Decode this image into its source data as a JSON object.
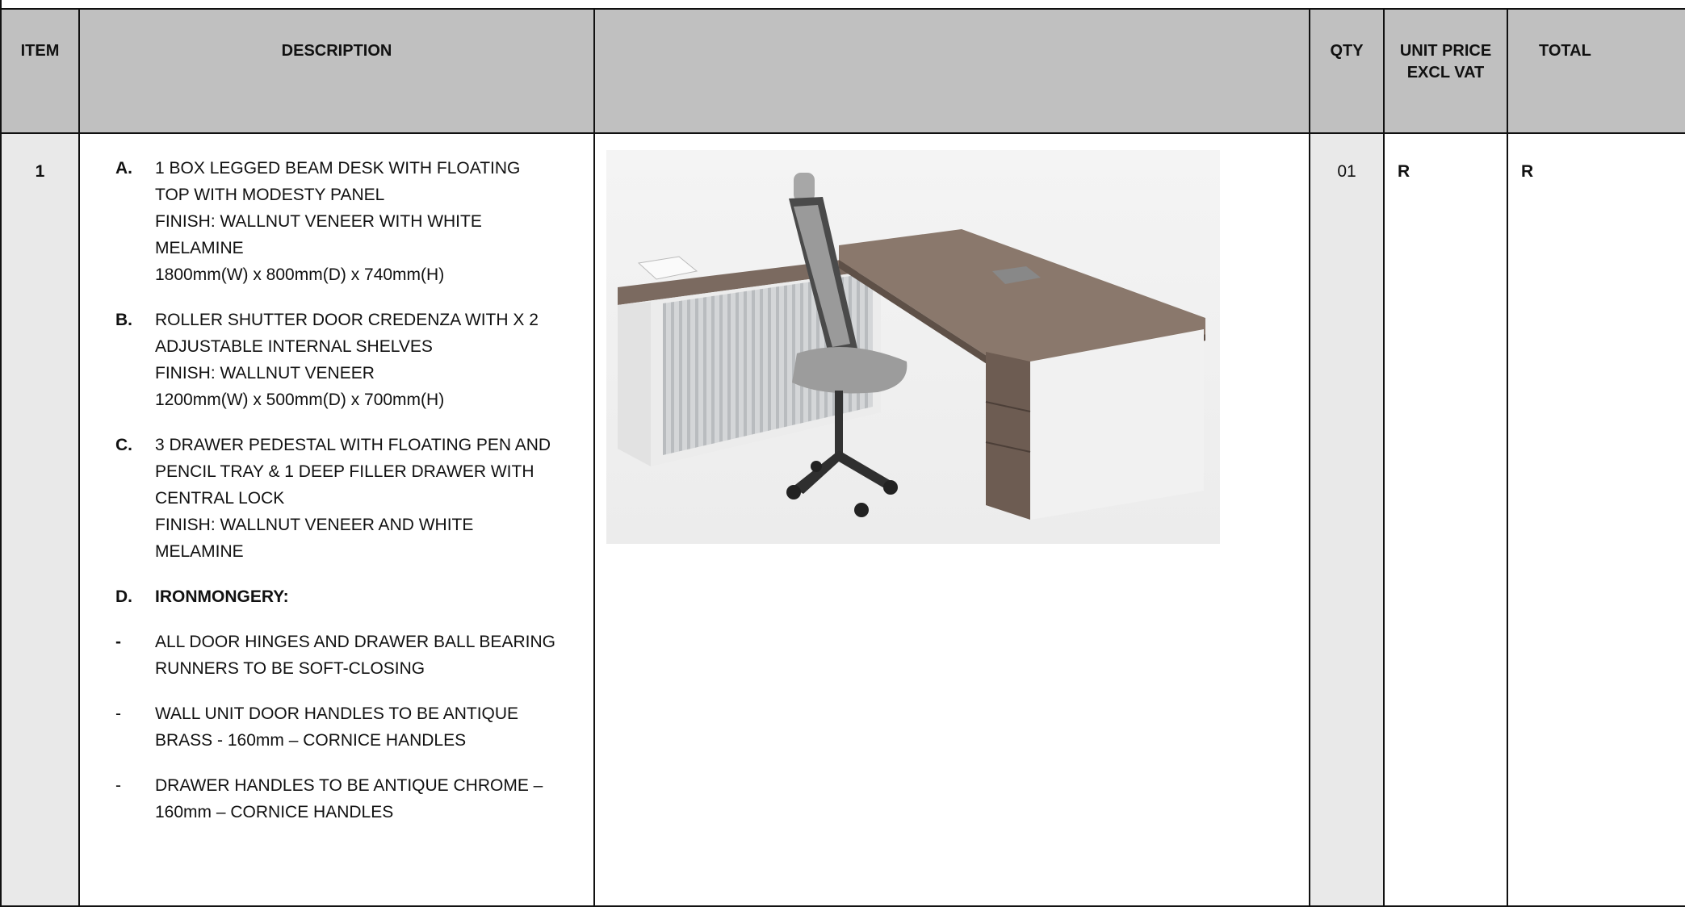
{
  "headers": {
    "item": "ITEM",
    "description": "DESCRIPTION",
    "image": "",
    "qty": "QTY",
    "unit_price_line1": "UNIT PRICE",
    "unit_price_line2": "EXCL VAT",
    "total": "TOTAL"
  },
  "row": {
    "item_no": "1",
    "qty": "01",
    "unit_price": "R",
    "total": "R",
    "items": [
      {
        "marker": "A.",
        "lines": [
          "1 BOX LEGGED BEAM DESK WITH FLOATING",
          "TOP WITH MODESTY PANEL",
          "FINISH: WALLNUT VENEER WITH WHITE",
          "MELAMINE",
          "1800mm(W) x 800mm(D) x 740mm(H)"
        ]
      },
      {
        "marker": "B.",
        "lines": [
          "ROLLER SHUTTER DOOR CREDENZA WITH X 2",
          "ADJUSTABLE INTERNAL SHELVES",
          "FINISH: WALLNUT VENEER",
          "1200mm(W) x 500mm(D) x 700mm(H)"
        ]
      },
      {
        "marker": "C.",
        "lines": [
          "3 DRAWER PEDESTAL WITH FLOATING PEN AND",
          "PENCIL TRAY & 1 DEEP FILLER DRAWER WITH",
          "CENTRAL LOCK",
          "FINISH: WALLNUT VENEER  AND WHITE",
          "MELAMINE"
        ]
      },
      {
        "marker": "D.",
        "lines": [
          "IRONMONGERY:"
        ]
      },
      {
        "marker": "-",
        "lines": [
          "ALL DOOR HINGES AND DRAWER BALL BEARING",
          "RUNNERS TO BE SOFT-CLOSING"
        ]
      },
      {
        "marker": "-",
        "lines": [
          "WALL UNIT DOOR HANDLES TO BE ANTIQUE",
          "BRASS - 160mm – CORNICE HANDLES"
        ]
      },
      {
        "marker": "-",
        "lines": [
          "DRAWER HANDLES TO BE ANTIQUE CHROME –",
          "160mm – CORNICE HANDLES"
        ]
      }
    ]
  },
  "colors": {
    "header_bg": "#c0c0c0",
    "shaded_col_bg": "#e9e9e9",
    "wood": "#7b6a60",
    "white_panel": "#eeeeee"
  }
}
